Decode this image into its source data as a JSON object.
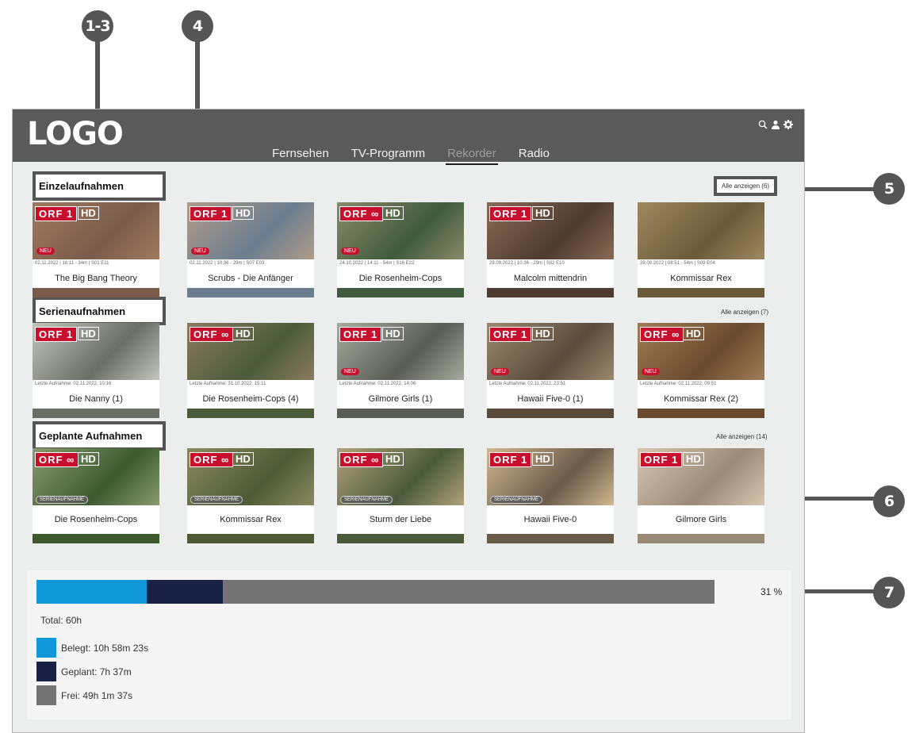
{
  "annotations": [
    "1-3",
    "4",
    "5",
    "6",
    "7"
  ],
  "header": {
    "logo": "LOGO",
    "nav": [
      "Fernsehen",
      "TV-Programm",
      "Rekorder",
      "Radio"
    ],
    "active_nav": "Rekorder",
    "icons": [
      "search-icon",
      "user-icon",
      "gear-icon"
    ]
  },
  "sections": [
    {
      "title": "Einzelaufnahmen",
      "show_all": "Alle anzeigen (6)",
      "cards": [
        {
          "channel": "ORF",
          "channel_num": "1",
          "hd": "HD",
          "badge": "NEU",
          "meta": "02.11.2022 | 16:11 - 34m | S01 E11",
          "title": "The Big Bang Theory"
        },
        {
          "channel": "ORF",
          "channel_num": "1",
          "hd": "HD",
          "badge": "NEU",
          "meta": "02.11.2022 | 10:36 - 29m | S07 E03",
          "title": "Scrubs - Die Anfänger"
        },
        {
          "channel": "ORF",
          "channel_num": "∞",
          "hd": "HD",
          "badge": "NEU",
          "meta": "24.10.2022 | 14:11 - 54m | S16 E22",
          "title": "Die Rosenheim-Cops"
        },
        {
          "channel": "ORF",
          "channel_num": "1",
          "hd": "HD",
          "badge": "",
          "meta": "29.09.2022 | 10:36 - 29m | S02 E10",
          "title": "Malcolm mittendrin"
        },
        {
          "channel": "",
          "channel_num": "",
          "hd": "",
          "badge": "",
          "meta": "28.09.2022 | 08:51 - 54m | S09 E04",
          "title": "Kommissar Rex"
        }
      ]
    },
    {
      "title": "Serienaufnahmen",
      "show_all": "Alle anzeigen (7)",
      "cards": [
        {
          "channel": "ORF",
          "channel_num": "1",
          "hd": "HD",
          "badge": "",
          "meta": "Letzte Aufnahme: 02.11.2022, 10:16",
          "title": "Die Nanny (1)"
        },
        {
          "channel": "ORF",
          "channel_num": "∞",
          "hd": "HD",
          "badge": "",
          "meta": "Letzte Aufnahme: 31.10.2022, 15:11",
          "title": "Die Rosenheim-Cops (4)"
        },
        {
          "channel": "ORF",
          "channel_num": "1",
          "hd": "HD",
          "badge": "NEU",
          "meta": "Letzte Aufnahme: 02.11.2022, 14:06",
          "title": "Gilmore Girls (1)"
        },
        {
          "channel": "ORF",
          "channel_num": "1",
          "hd": "HD",
          "badge": "NEU",
          "meta": "Letzte Aufnahme: 02.11.2022, 23:51",
          "title": "Hawaii Five-0 (1)"
        },
        {
          "channel": "ORF",
          "channel_num": "∞",
          "hd": "HD",
          "badge": "NEU",
          "meta": "Letzte Aufnahme: 02.11.2022, 09:51",
          "title": "Kommissar Rex (2)"
        }
      ]
    },
    {
      "title": "Geplante Aufnahmen",
      "show_all": "Alle anzeigen (14)",
      "cards": [
        {
          "channel": "ORF",
          "channel_num": "∞",
          "hd": "HD",
          "badge": "SERIENAUFNAHME",
          "meta": "",
          "title": "Die Rosenheim-Cops"
        },
        {
          "channel": "ORF",
          "channel_num": "∞",
          "hd": "HD",
          "badge": "SERIENAUFNAHME",
          "meta": "",
          "title": "Kommissar Rex"
        },
        {
          "channel": "ORF",
          "channel_num": "∞",
          "hd": "HD",
          "badge": "SERIENAUFNAHME",
          "meta": "",
          "title": "Sturm der Liebe"
        },
        {
          "channel": "ORF",
          "channel_num": "1",
          "hd": "HD",
          "badge": "SERIENAUFNAHME",
          "meta": "",
          "title": "Hawaii Five-0"
        },
        {
          "channel": "ORF",
          "channel_num": "1",
          "hd": "HD",
          "badge": "",
          "meta": "",
          "title": "Gilmore Girls"
        }
      ]
    }
  ],
  "storage": {
    "percent_label": "31 %",
    "total": "Total: 60h",
    "segments": [
      {
        "label": "Belegt: 10h 58m 23s",
        "color": "#0f97d9",
        "hours": 10.97
      },
      {
        "label": "Geplant: 7h 37m",
        "color": "#1a2147",
        "hours": 7.62
      },
      {
        "label": "Frei: 49h 1m 37s",
        "color": "#737373",
        "hours": 49.03
      }
    ]
  }
}
